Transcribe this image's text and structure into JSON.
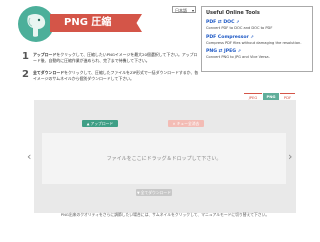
{
  "header": {
    "title": "PNG 圧縮",
    "language_selected": "日本語"
  },
  "tools": {
    "heading": "Useful Online Tools",
    "items": [
      {
        "name": "PDF ⇄ DOC",
        "desc": "Convert PDF to DOC and DOC to PDF"
      },
      {
        "name": "PDF Compressor",
        "desc": "Compress PDF files without damaging the resolution."
      },
      {
        "name": "PNG ⇄ JPEG",
        "desc": "Convert PNG to JPG and Vice Versa."
      }
    ]
  },
  "steps": [
    {
      "num": "1",
      "bold": "アップロード",
      "text": "をクリックして、圧縮したいPNGイメージを最大20個選択して下さい。アップロード後、自動的に圧縮作業が進められ、完了まで待機して下さい。"
    },
    {
      "num": "2",
      "bold": "全てダウンロード",
      "text": "をクリックして、圧縮したファイルをZIP形式で一括ダウンロードするか、各イメージのサムネイルから個別ダウンロードして下さい。"
    }
  ],
  "tabs": [
    "JPEG",
    "PNG",
    "PDF"
  ],
  "main": {
    "upload_label": "アップロード",
    "clear_label": "キュー全消去",
    "dropzone_text": "ファイルをここにドラッグ＆ドロップして下さい。",
    "download_all_label": "全てダウンロード",
    "arrow_left": "‹",
    "arrow_right": "›",
    "footnote": "PNG出来のクオリティをさらに調節したい場合には、サムネイルをクリックして、マニュアルモードに切り替えて下さい。"
  },
  "colors": {
    "brand_red": "#d45548",
    "brand_green": "#3f9f86",
    "tab_active": "#5fae9a",
    "panel_bg": "#e9e9e9"
  }
}
